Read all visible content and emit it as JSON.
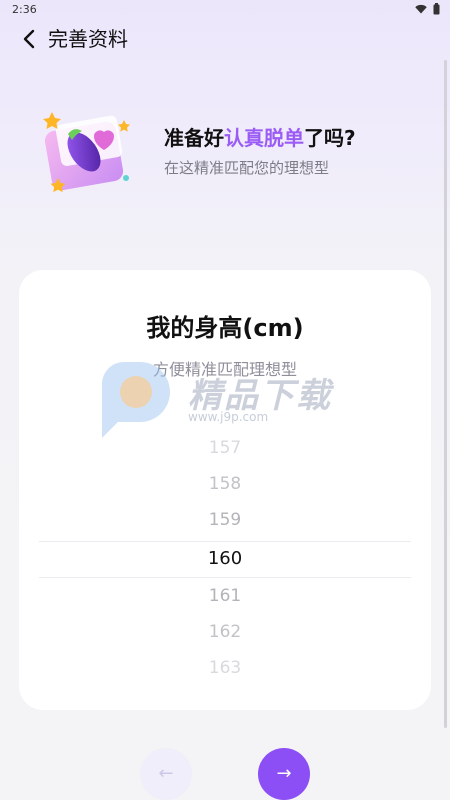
{
  "status_bar": {
    "time": "2:36"
  },
  "nav": {
    "title": "完善资料"
  },
  "hero": {
    "title_pre": "准备好",
    "title_highlight": "认真脱单",
    "title_post": "了吗?",
    "subtitle": "在这精准匹配您的理想型",
    "accent_color": "#9b5cf6"
  },
  "card": {
    "title": "我的身高(cm)",
    "subtitle": "方便精准匹配理想型"
  },
  "picker": {
    "items": [
      "157",
      "158",
      "159",
      "160",
      "161",
      "162",
      "163"
    ],
    "selected": "160"
  },
  "watermark": {
    "text": "精品下载",
    "url": "www.j9p.com"
  },
  "buttons": {
    "prev_icon": "arrow-left-icon",
    "next_icon": "arrow-right-icon",
    "prev_symbol": "←",
    "next_symbol": "→"
  },
  "colors": {
    "primary": "#8b4ff5",
    "prev_bg": "#f0eefa"
  }
}
